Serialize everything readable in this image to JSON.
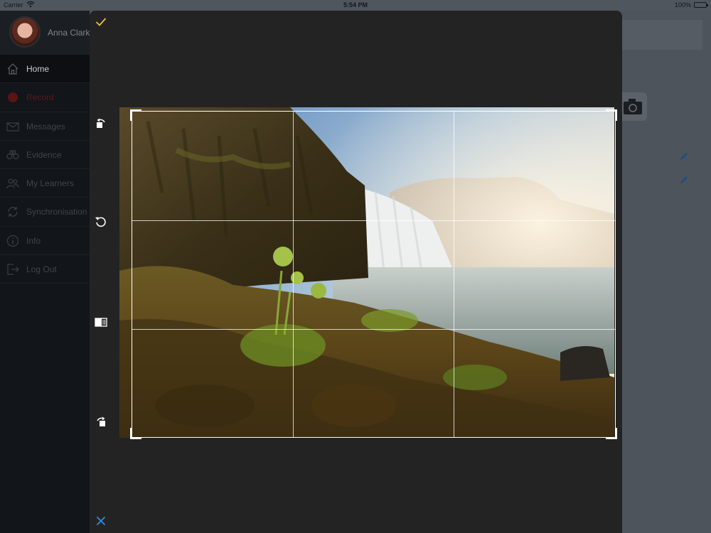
{
  "status_bar": {
    "carrier": "Carrier",
    "time": "5:54 PM",
    "battery": "100%"
  },
  "profile": {
    "name": "Anna Clark"
  },
  "menu": [
    {
      "label": "Home",
      "icon": "home-icon",
      "active": true
    },
    {
      "label": "Record",
      "icon": "record-icon"
    },
    {
      "label": "Messages",
      "icon": "envelope-icon"
    },
    {
      "label": "Evidence",
      "icon": "binoculars-icon"
    },
    {
      "label": "My Learners",
      "icon": "users-icon"
    },
    {
      "label": "Synchronisation",
      "icon": "sync-icon"
    },
    {
      "label": "Info",
      "icon": "info-icon"
    },
    {
      "label": "Log Out",
      "icon": "logout-icon"
    }
  ],
  "crop_editor": {
    "confirm_icon": "checkmark-icon",
    "cancel_icon": "close-icon",
    "tools": [
      "rotate-left-icon",
      "reset-icon",
      "aspect-ratio-icon",
      "rotate-right-icon"
    ],
    "photo_subject": "waterfall-landscape",
    "colors": {
      "accent_confirm": "#f2c230",
      "accent_cancel": "#2f8ce8",
      "frame": "#ffffff",
      "modal_bg": "#232323"
    }
  }
}
